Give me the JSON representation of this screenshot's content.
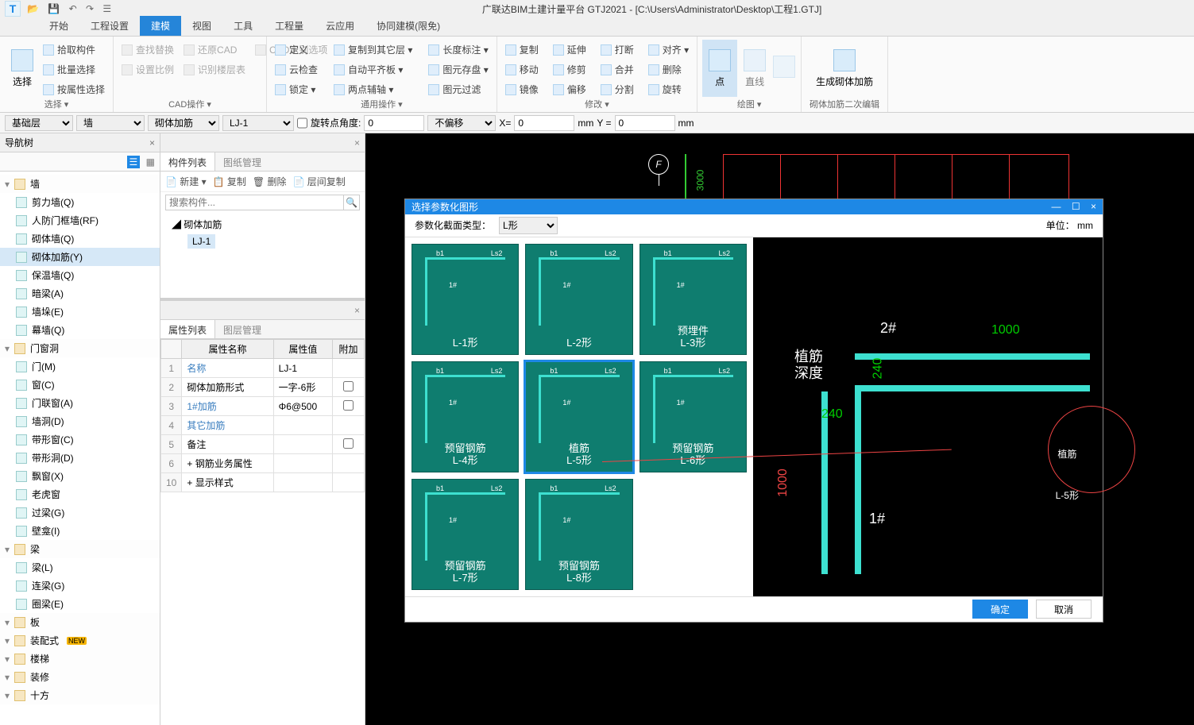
{
  "title": "广联达BIM土建计量平台 GTJ2021 - [C:\\Users\\Administrator\\Desktop\\工程1.GTJ]",
  "ribbon_tabs": [
    "开始",
    "工程设置",
    "建模",
    "视图",
    "工具",
    "工程量",
    "云应用",
    "协同建模(限免)"
  ],
  "active_ribbon_tab": 2,
  "ribbon": {
    "select": {
      "big": "选择",
      "items": [
        "拾取构件",
        "批量选择",
        "按属性选择"
      ],
      "group_label": "选择 ▾"
    },
    "cad": {
      "items_disabled": [
        "查找替换",
        "设置比例",
        "还原CAD",
        "识别楼层表",
        "CAD识别选项"
      ],
      "group_label": "CAD操作 ▾"
    },
    "generic": {
      "col1": [
        "定义",
        "云检查",
        "锁定 ▾"
      ],
      "col2": [
        "复制到其它层 ▾",
        "自动平齐板 ▾",
        "两点辅轴 ▾"
      ],
      "col3": [
        "长度标注 ▾",
        "图元存盘 ▾",
        "图元过滤"
      ],
      "group_label": "通用操作 ▾"
    },
    "edit": {
      "col1": [
        "复制",
        "移动",
        "镜像"
      ],
      "col2": [
        "延伸",
        "修剪",
        "偏移"
      ],
      "col3": [
        "打断",
        "合并",
        "分割"
      ],
      "col4": [
        "对齐 ▾",
        "删除",
        "旋转"
      ],
      "group_label": "修改 ▾"
    },
    "draw": {
      "big1": "点",
      "big2": "直线",
      "group_label": "绘图 ▾"
    },
    "special": {
      "big": "生成砌体加筋",
      "group_label": "砌体加筋二次编辑"
    }
  },
  "option_bar": {
    "sel1": "基础层",
    "sel2": "墙",
    "sel3": "砌体加筋",
    "sel4": "LJ-1",
    "rot_label": "旋转点角度:",
    "rot_val": "0",
    "off_label": "不偏移",
    "x_label": "X=",
    "x_val": "0",
    "mm1": "mm",
    "y_label": "Y =",
    "y_val": "0",
    "mm2": "mm"
  },
  "nav": {
    "header": "导航树",
    "tree": [
      {
        "label": "墙",
        "cat": true
      },
      {
        "label": "剪力墙(Q)"
      },
      {
        "label": "人防门框墙(RF)"
      },
      {
        "label": "砌体墙(Q)"
      },
      {
        "label": "砌体加筋(Y)",
        "selected": true
      },
      {
        "label": "保温墙(Q)"
      },
      {
        "label": "暗梁(A)"
      },
      {
        "label": "墙垛(E)"
      },
      {
        "label": "幕墙(Q)"
      },
      {
        "label": "门窗洞",
        "cat": true
      },
      {
        "label": "门(M)"
      },
      {
        "label": "窗(C)"
      },
      {
        "label": "门联窗(A)"
      },
      {
        "label": "墙洞(D)"
      },
      {
        "label": "带形窗(C)"
      },
      {
        "label": "带形洞(D)"
      },
      {
        "label": "飘窗(X)"
      },
      {
        "label": "老虎窗"
      },
      {
        "label": "过梁(G)"
      },
      {
        "label": "壁龛(I)"
      },
      {
        "label": "梁",
        "cat": true
      },
      {
        "label": "梁(L)"
      },
      {
        "label": "连梁(G)"
      },
      {
        "label": "圈梁(E)"
      },
      {
        "label": "板",
        "cat": true
      },
      {
        "label": "装配式",
        "cat": true,
        "new": true
      },
      {
        "label": "楼梯",
        "cat": true
      },
      {
        "label": "装修",
        "cat": true
      },
      {
        "label": "十方",
        "cat": true
      }
    ]
  },
  "mid": {
    "tabs": [
      "构件列表",
      "图纸管理"
    ],
    "toolbar": [
      "新建 ▾",
      "复制",
      "删除",
      "层间复制"
    ],
    "search_placeholder": "搜索构件...",
    "tree_parent": "砌体加筋",
    "tree_child": "LJ-1"
  },
  "props": {
    "tabs": [
      "属性列表",
      "图层管理"
    ],
    "cols": [
      "属性名称",
      "属性值",
      "附加"
    ],
    "rows": [
      {
        "i": "1",
        "n": "名称",
        "v": "LJ-1",
        "link": true
      },
      {
        "i": "2",
        "n": "砌体加筋形式",
        "v": "一字-6形",
        "chk": false
      },
      {
        "i": "3",
        "n": "1#加筋",
        "v": "Φ6@500",
        "link": true,
        "chk": false
      },
      {
        "i": "4",
        "n": "其它加筋",
        "v": "",
        "link": true
      },
      {
        "i": "5",
        "n": "备注",
        "v": "",
        "chk": false
      },
      {
        "i": "6",
        "n": "钢筋业务属性",
        "v": "",
        "exp": "+"
      },
      {
        "i": "10",
        "n": "显示样式",
        "v": "",
        "exp": "+"
      }
    ]
  },
  "viewport": {
    "grid_label": "F",
    "dim_v": "3000"
  },
  "modal": {
    "title": "选择参数化图形",
    "type_label": "参数化截面类型：",
    "type_val": "L形",
    "unit_label": "单位：    mm",
    "thumbs": [
      {
        "label": "L-1形"
      },
      {
        "label": "L-2形"
      },
      {
        "label": "预埋件\nL-3形"
      },
      {
        "label": "预留钢筋\nL-4形"
      },
      {
        "label": "植筋\nL-5形",
        "selected": true
      },
      {
        "label": "预留钢筋\nL-6形"
      },
      {
        "label": "预留钢筋\nL-7形"
      },
      {
        "label": "预留钢筋\nL-8形"
      }
    ],
    "preview": {
      "t2": "2#",
      "t1": "1#",
      "d_top": "1000",
      "d_left": "1000",
      "d_w": "240",
      "d_h": "240",
      "depth": "植筋\n深度",
      "big": "植筋\nL-5形"
    },
    "ok": "确定",
    "cancel": "取消"
  }
}
